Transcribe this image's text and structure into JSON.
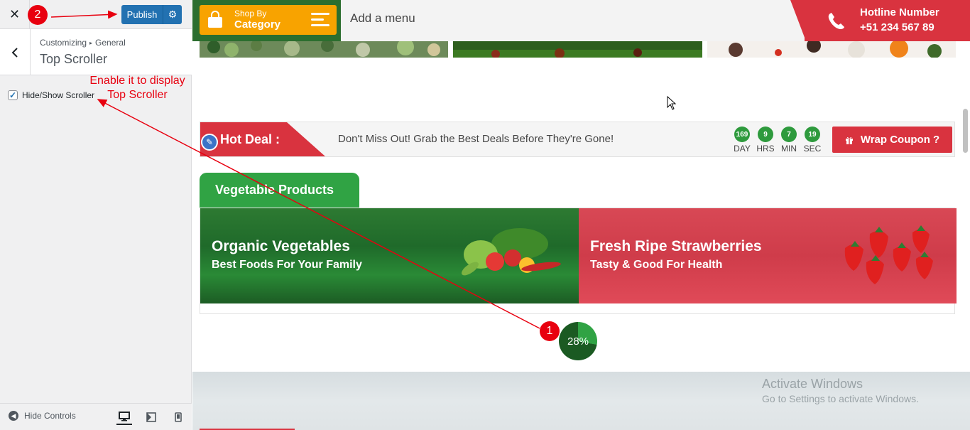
{
  "sidebar": {
    "close_icon": "close-icon",
    "publish_label": "Publish",
    "gear_icon": "gear-icon",
    "breadcrumb": [
      "Customizing",
      "General"
    ],
    "section_title": "Top Scroller",
    "option_label": "Hide/Show Scroller",
    "option_checked": true,
    "hide_controls_label": "Hide Controls",
    "devices": [
      "desktop-icon",
      "tablet-icon",
      "mobile-icon"
    ]
  },
  "annotations": {
    "step1": "1",
    "step2": "2",
    "hint_line1": "Enable it to display",
    "hint_line2": "Top Scroller",
    "color": "#e8000f"
  },
  "header": {
    "category_line1": "Shop By",
    "category_line2": "Category",
    "menu_placeholder": "Add a menu",
    "hotline_title": "Hotline Number",
    "hotline_number": "+51 234 567 89"
  },
  "hot_deal": {
    "label": "Hot Deal :",
    "message": "Don't Miss Out! Grab the Best Deals Before They're Gone!",
    "countdown": [
      {
        "value": "169",
        "unit": "DAY"
      },
      {
        "value": "9",
        "unit": "HRS"
      },
      {
        "value": "7",
        "unit": "MIN"
      },
      {
        "value": "19",
        "unit": "SEC"
      }
    ],
    "coupon_label": "Wrap Coupon ?"
  },
  "products": {
    "tab_label": "Vegetable Products",
    "banners": [
      {
        "title": "Organic Vegetables",
        "subtitle": "Best Foods For Your Family"
      },
      {
        "title": "Fresh Ripe Strawberries",
        "subtitle": "Tasty & Good For Health"
      }
    ]
  },
  "scroller": {
    "progress_label": "28%",
    "progress_value": 0.28
  },
  "watermark": {
    "line1": "Activate Windows",
    "line2": "Go to Settings to activate Windows."
  },
  "colors": {
    "brand_green": "#30a344",
    "brand_red": "#d9333f",
    "brand_orange": "#f8a300",
    "wp_blue": "#2271b1"
  }
}
